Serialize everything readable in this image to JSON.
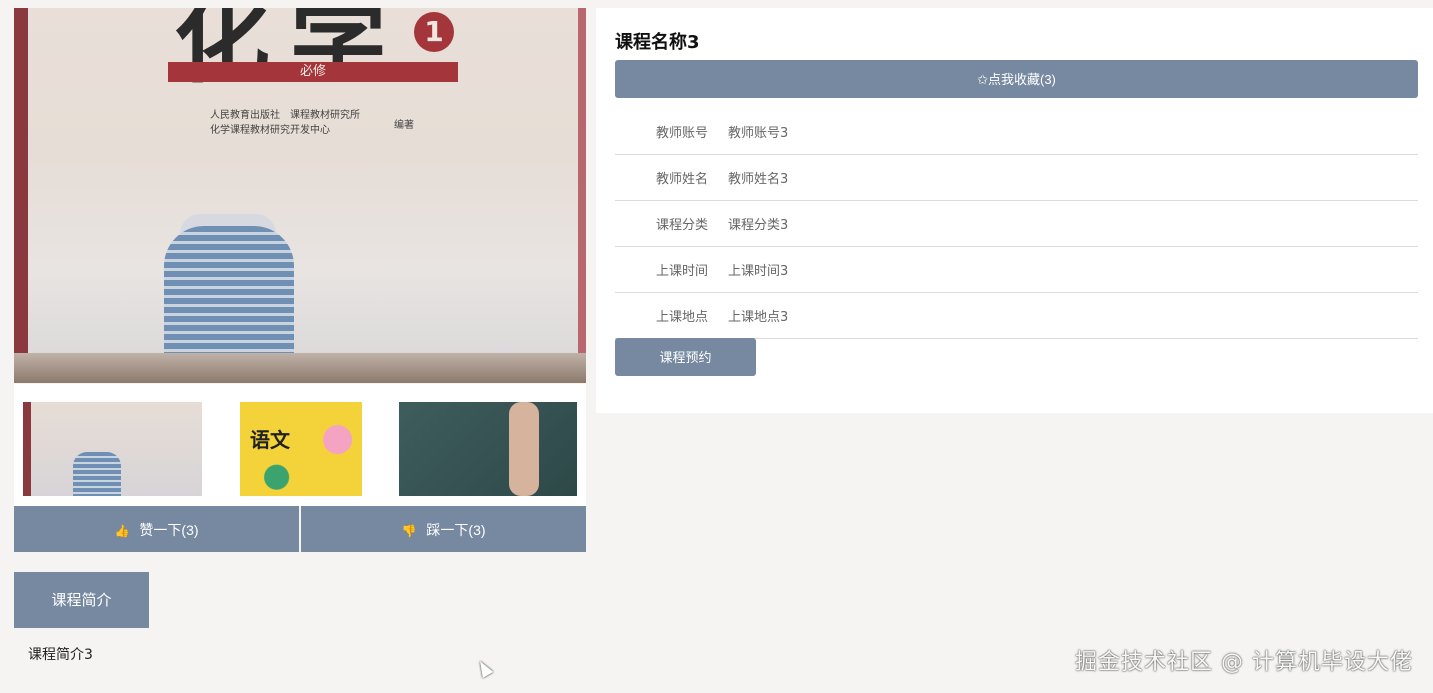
{
  "gallery": {
    "main_cover_title": "化学",
    "main_cover_number": "1",
    "main_cover_sub": "必修",
    "main_cover_publisher": "人民教育出版社　课程教材研究所",
    "main_cover_publisher2": "化学课程教材研究开发中心",
    "main_cover_author": "编著",
    "thumb2_text": "语文"
  },
  "votes": {
    "like_icon": "thumbs-up-icon",
    "like_label": "赞一下(3)",
    "dislike_icon": "thumbs-down-icon",
    "dislike_label": "踩一下(3)"
  },
  "detail": {
    "title": "课程名称3",
    "favorite_label": "✩点我收藏(3)",
    "rows": [
      {
        "label": "教师账号",
        "value": "教师账号3"
      },
      {
        "label": "教师姓名",
        "value": "教师姓名3"
      },
      {
        "label": "课程分类",
        "value": "课程分类3"
      },
      {
        "label": "上课时间",
        "value": "上课时间3"
      },
      {
        "label": "上课地点",
        "value": "上课地点3"
      }
    ],
    "book_label": "课程预约"
  },
  "intro": {
    "tab_label": "课程简介",
    "text": "课程简介3"
  },
  "watermark": "掘金技术社区 @ 计算机毕设大佬",
  "colors": {
    "accent": "#7689a0",
    "background": "#f5f4f2",
    "panel": "#ffffff"
  }
}
